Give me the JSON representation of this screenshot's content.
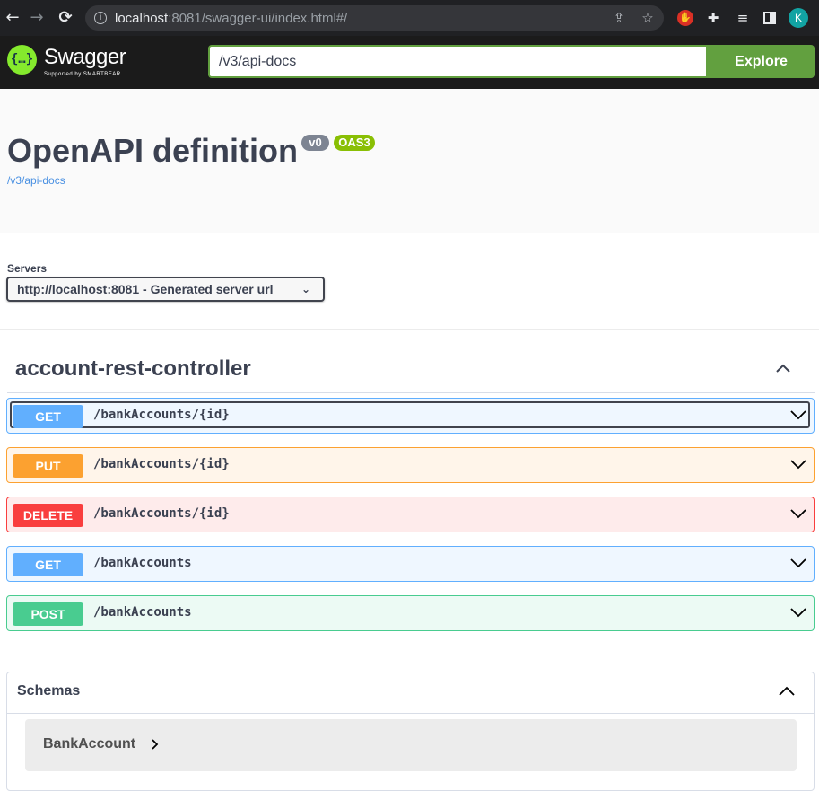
{
  "browser": {
    "back_icon": "←",
    "forward_icon": "→",
    "reload_icon": "⟳",
    "url_host": "localhost",
    "url_rest": ":8081/swagger-ui/index.html#/",
    "avatar_letter": "K"
  },
  "topbar": {
    "logo_mark": "{…}",
    "logo_text": "Swagger",
    "logo_sub": "Supported by SMARTBEAR",
    "spec_url": "/v3/api-docs",
    "explore_label": "Explore"
  },
  "info": {
    "title": "OpenAPI definition",
    "version": "v0",
    "oas": "OAS3",
    "link": "/v3/api-docs"
  },
  "servers": {
    "label": "Servers",
    "selected": "http://localhost:8081 - Generated server url"
  },
  "tag": {
    "name": "account-rest-controller"
  },
  "operations": [
    {
      "method": "GET",
      "path": "/bankAccounts/{id}"
    },
    {
      "method": "PUT",
      "path": "/bankAccounts/{id}"
    },
    {
      "method": "DELETE",
      "path": "/bankAccounts/{id}"
    },
    {
      "method": "GET",
      "path": "/bankAccounts"
    },
    {
      "method": "POST",
      "path": "/bankAccounts"
    }
  ],
  "schemas": {
    "title": "Schemas",
    "models": [
      {
        "name": "BankAccount"
      }
    ]
  },
  "colors": {
    "get": "#61affe",
    "put": "#fca130",
    "delete": "#f93e3e",
    "post": "#49cc90",
    "explore": "#62a03f"
  }
}
